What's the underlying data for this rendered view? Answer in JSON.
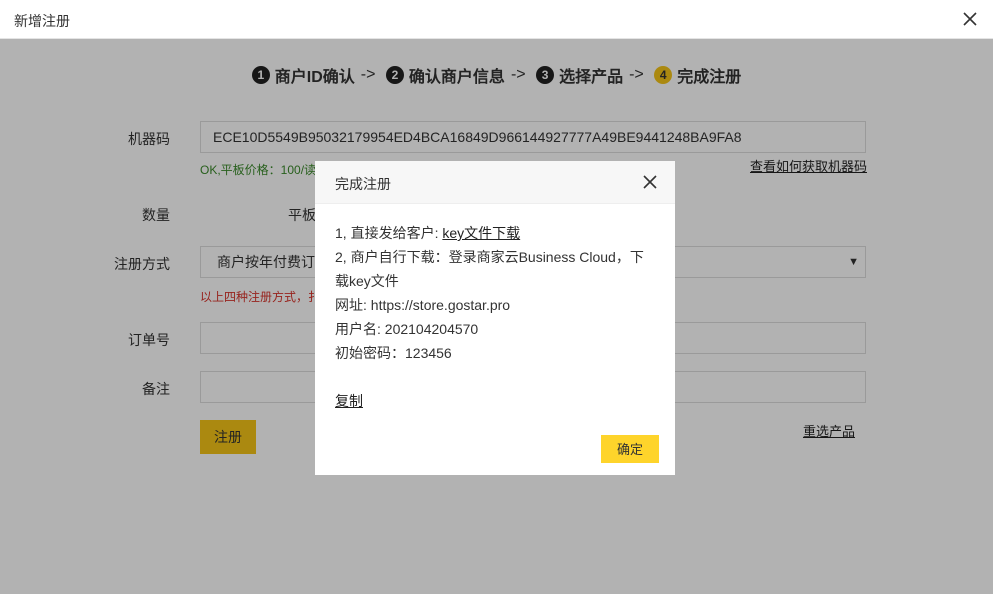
{
  "window": {
    "title": "新增注册"
  },
  "steps": [
    {
      "num": "1",
      "label": "商户ID确认"
    },
    {
      "num": "2",
      "label": "确认商户信息"
    },
    {
      "num": "3",
      "label": "选择产品"
    },
    {
      "num": "4",
      "label": "完成注册"
    }
  ],
  "step_arrow": "->",
  "form": {
    "machine_code": {
      "label": "机器码",
      "value": "ECE10D5549B95032179954ED4BCA16849D966144927777A49BE9441248BA9FA8",
      "hint": "OK,平板价格：100/读",
      "help_link": "查看如何获取机器码"
    },
    "quantity": {
      "label": "数量",
      "value": "平板"
    },
    "method": {
      "label": "注册方式",
      "value": "商户按年付费订",
      "hint": "以上四种注册方式，扌"
    },
    "order_no": {
      "label": "订单号",
      "value": ""
    },
    "remark": {
      "label": "备注",
      "value": ""
    },
    "register_button": "注册",
    "reselect_link": "重选产品"
  },
  "modal": {
    "title": "完成注册",
    "line1_prefix": "1, 直接发给客户: ",
    "line1_link": "key文件下载",
    "line2": "2, 商户自行下载：登录商家云Business Cloud，下载key文件",
    "url_line": "网址: https://store.gostar.pro",
    "username_line": "用户名: 202104204570",
    "password_line": "初始密码：123456",
    "copy_link": "复制",
    "confirm_button": "确定"
  },
  "colors": {
    "accent": "#f5c518",
    "confirm": "#fed42b",
    "ok_text": "#3a8a2a",
    "warn_text": "#d9342b"
  }
}
